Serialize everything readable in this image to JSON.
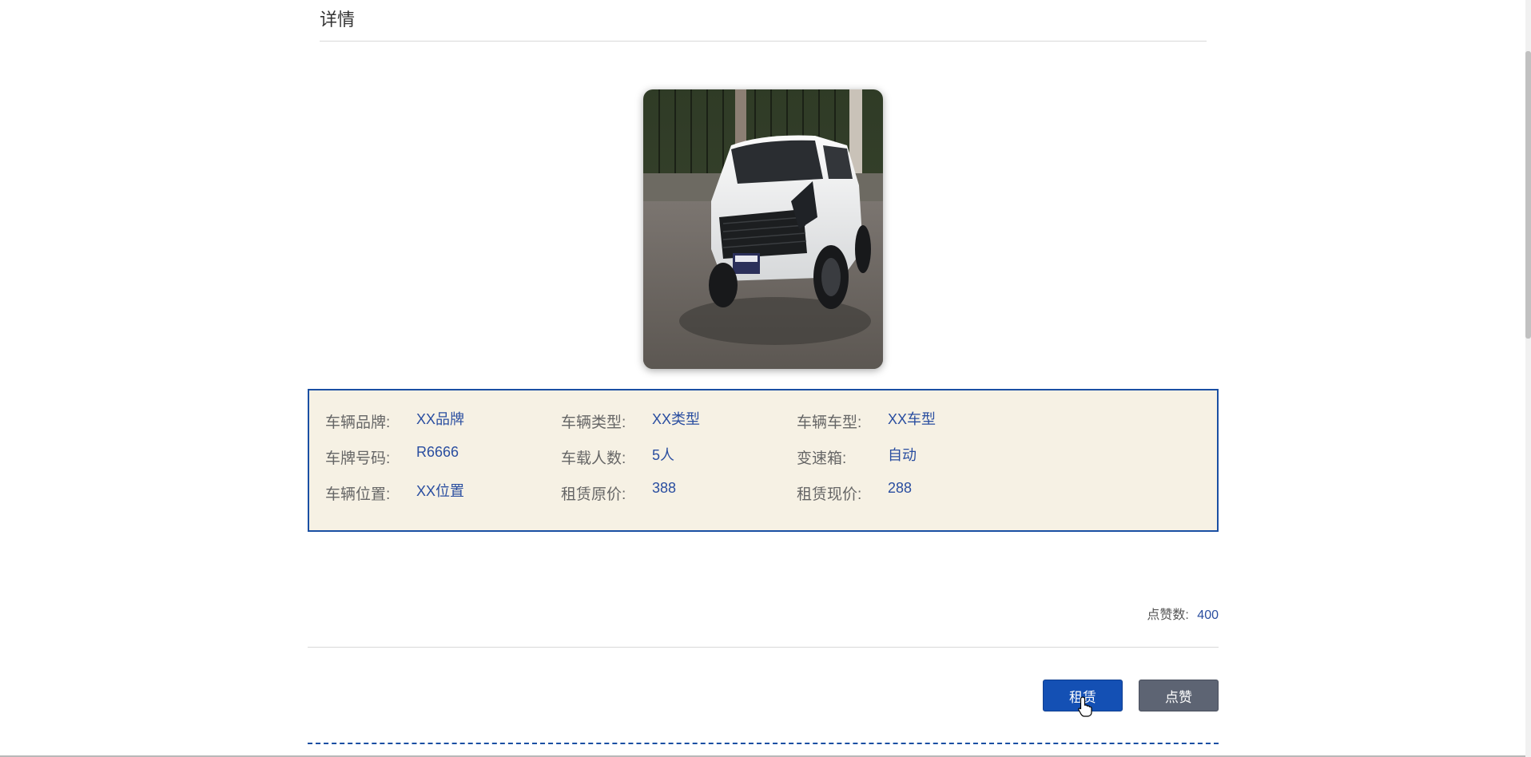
{
  "header": {
    "title": "详情"
  },
  "image": {
    "alt": "car-photo"
  },
  "info": {
    "rows": [
      [
        {
          "label": "车辆品牌:",
          "value": "XX品牌"
        },
        {
          "label": "车辆类型:",
          "value": "XX类型"
        },
        {
          "label": "车辆车型:",
          "value": "XX车型"
        }
      ],
      [
        {
          "label": "车牌号码:",
          "value": "R6666"
        },
        {
          "label": "车载人数:",
          "value": "5人"
        },
        {
          "label": "变速箱:",
          "value": "自动"
        }
      ],
      [
        {
          "label": "车辆位置:",
          "value": "XX位置"
        },
        {
          "label": "租赁原价:",
          "value": "388"
        },
        {
          "label": "租赁现价:",
          "value": "288"
        }
      ]
    ]
  },
  "likes": {
    "label": "点赞数:",
    "count": "400"
  },
  "buttons": {
    "rent_label": "租赁",
    "like_label": "点赞"
  },
  "colors": {
    "accent": "#1450b4",
    "value_text": "#2a4ea0",
    "info_bg": "#f6f1e4",
    "like_button": "#5d6473"
  }
}
